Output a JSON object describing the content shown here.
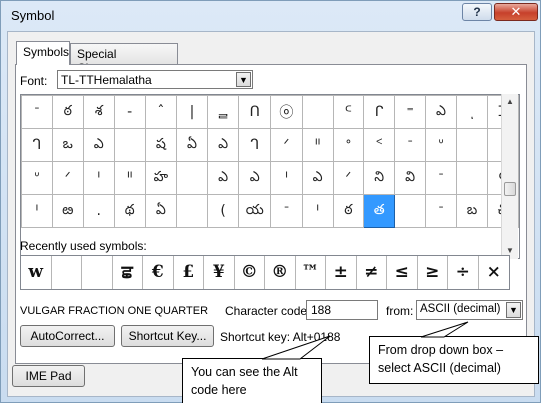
{
  "window": {
    "title": "Symbol",
    "help": "?",
    "close": "✕"
  },
  "tabs": [
    {
      "label": "Symbols"
    },
    {
      "label": "Special Characters"
    }
  ],
  "font": {
    "label": "Font:",
    "value": "TL-TTHemalatha"
  },
  "symbol_grid": {
    "rows": [
      [
        "ᐨ",
        "ఠ",
        "శ",
        "-",
        "ˆ",
        "|",
        "ᆯ",
        "ᑎ",
        "ⓞ",
        "",
        "ᒼ",
        "ᒋ",
        "⁼",
        "ఎ",
        "ͺ",
        "ᑐ"
      ],
      [
        "ᒉ",
        "ఒ",
        "ఎ",
        "",
        "ష",
        "ఏ",
        "ఎ",
        "ᒉ",
        "ᐟ",
        "ᐦ",
        "ᐤ",
        "ᑉ",
        "ᐨ",
        "ᐡ",
        "",
        ""
      ],
      [
        "ᐡ",
        "ᐟ",
        "ᑊ",
        "ᐦ",
        "హ",
        "",
        "ఎ",
        "ఎ",
        "ᑊ",
        "ఎ",
        "ᐟ",
        "ని",
        "వి",
        "ᐨ",
        "",
        "౸"
      ],
      [
        "ᑊ",
        "ఴ",
        ".",
        "థ",
        "ఏ",
        "",
        "(",
        "య",
        "ᐨ",
        "ᑊ",
        "ఠ",
        "త",
        "",
        "ᐨ",
        "బ",
        "చి"
      ]
    ],
    "selected": "త"
  },
  "recent": {
    "label": "Recently used symbols:",
    "items": [
      "w",
      "",
      "",
      "ਛ",
      "€",
      "£",
      "¥",
      "©",
      "®",
      "™",
      "±",
      "≠",
      "≤",
      "≥",
      "÷",
      "×"
    ]
  },
  "character": {
    "name": "VULGAR FRACTION ONE QUARTER",
    "code_label": "Character code:",
    "code_value": "188",
    "from_label": "from:",
    "from_value": "ASCII (decimal)"
  },
  "buttons": {
    "autocorrect": "AutoCorrect...",
    "shortcut_key": "Shortcut Key...",
    "ime_pad": "IME Pad"
  },
  "shortcut_text": "Shortcut key: Alt+0188",
  "callouts": {
    "alt_line1": "You can see the Alt",
    "alt_line2": "code here",
    "ascii_line1": "From drop down box –",
    "ascii_line2": "select ASCII (decimal)"
  },
  "colors": {
    "selection": "#3399ff",
    "titlebar": "#dce9f7",
    "close": "#c7402b"
  }
}
